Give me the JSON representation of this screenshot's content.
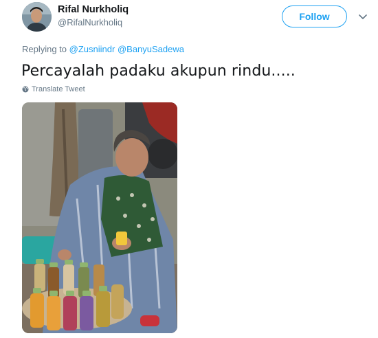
{
  "tweet": {
    "author": {
      "display_name": "Rifal Nurkholiq",
      "handle": "@RifalNurkholiq",
      "avatar_icon": "profile-photo"
    },
    "follow_label": "Follow",
    "caret_icon": "chevron-down-icon",
    "reply": {
      "prefix": "Replying to ",
      "mentions": [
        "@Zusniindr",
        "@BanyuSadewa"
      ]
    },
    "text": "Percayalah padaku akupun rindu.....",
    "translate_label": "Translate Tweet",
    "translate_icon": "globe-icon",
    "media": {
      "description_icon": "photo-elderly-woman-selling-bottled-drinks"
    }
  },
  "colors": {
    "accent": "#1da1f2",
    "text_primary": "#14171a",
    "text_secondary": "#657786"
  }
}
